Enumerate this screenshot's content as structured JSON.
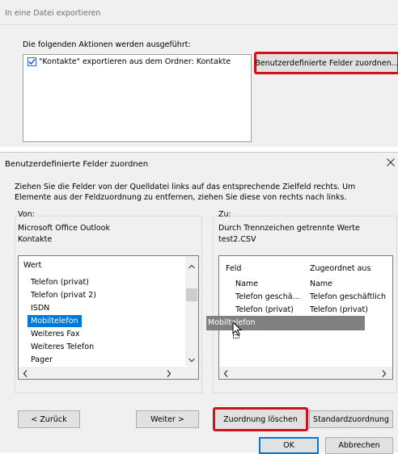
{
  "export_window": {
    "title": "In eine Datei exportieren",
    "actions_label": "Die folgenden Aktionen werden ausgeführt:",
    "action_item": "\"Kontakte\" exportieren aus dem Ordner: Kontakte",
    "action_checked": true,
    "custom_fields_button": "Benutzerdefinierte Felder zuordnen..."
  },
  "dialog": {
    "title": "Benutzerdefinierte Felder zuordnen",
    "instructions": "Ziehen Sie die Felder von der Quelldatei links auf das entsprechende Zielfeld rechts. Um Elemente aus der Feldzuordnung zu entfernen, ziehen Sie diese von rechts nach links.",
    "from": {
      "label": "Von:",
      "line1": "Microsoft Office Outlook",
      "line2": "Kontakte",
      "list_header": "Wert",
      "items": [
        "Telefon (privat)",
        "Telefon (privat 2)",
        "ISDN",
        "Mobiltelefon",
        "Weiteres Fax",
        "Weiteres Telefon",
        "Pager"
      ],
      "selected_index": 3
    },
    "to": {
      "label": "Zu:",
      "line1": "Durch Trennzeichen getrennte Werte",
      "line2": "test2.CSV",
      "col_field": "Feld",
      "col_mapped": "Zugeordnet aus",
      "rows": [
        {
          "field": "Name",
          "mapped": "Name"
        },
        {
          "field": "Telefon geschä...",
          "mapped": "Telefon geschäftlich"
        },
        {
          "field": "Telefon (privat)",
          "mapped": "Telefon (privat)"
        }
      ]
    },
    "drag_ghost": "Mobiltelefon",
    "buttons": {
      "back": "< Zurück",
      "next": "Weiter >",
      "clear_map": "Zuordnung löschen",
      "default_map": "Standardzuordnung",
      "ok": "OK",
      "cancel": "Abbrechen"
    }
  },
  "colors": {
    "highlight_red": "#d0101b",
    "selection_blue": "#0078d7",
    "dialog_bg": "#f0f0f0"
  }
}
